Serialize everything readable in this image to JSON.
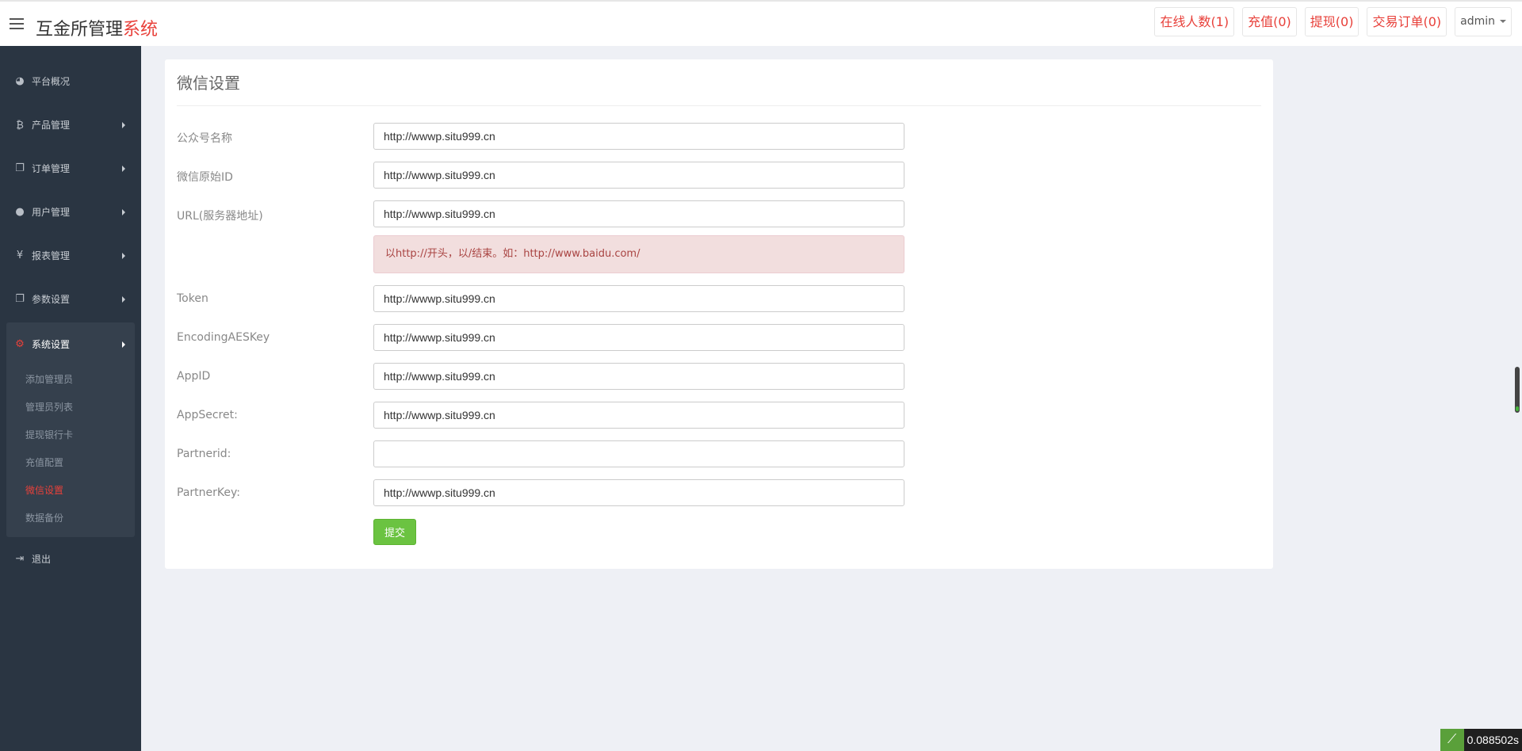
{
  "header": {
    "brand_main": "互金所管理",
    "brand_accent": "系统",
    "nav": {
      "online": "在线人数(1)",
      "recharge": "充值(0)",
      "withdraw": "提现(0)",
      "orders": "交易订单(0)",
      "user": "admin"
    }
  },
  "sidebar": {
    "items": [
      {
        "label": "平台概况",
        "icon": "dashboard-icon"
      },
      {
        "label": "产品管理",
        "icon": "bitcoin-icon"
      },
      {
        "label": "订单管理",
        "icon": "copy-icon"
      },
      {
        "label": "用户管理",
        "icon": "user-icon"
      },
      {
        "label": "报表管理",
        "icon": "yen-icon"
      },
      {
        "label": "参数设置",
        "icon": "copy-icon"
      },
      {
        "label": "系统设置",
        "icon": "gears-icon"
      },
      {
        "label": "退出",
        "icon": "sign-out-icon"
      }
    ],
    "sub_items": [
      "添加管理员",
      "管理员列表",
      "提现银行卡",
      "充值配置",
      "微信设置",
      "数据备份"
    ],
    "active_sub": "微信设置"
  },
  "panel": {
    "title": "微信设置",
    "fields": [
      {
        "label": "公众号名称",
        "value": "http://wwwp.situ999.cn"
      },
      {
        "label": "微信原始ID",
        "value": "http://wwwp.situ999.cn"
      },
      {
        "label": "URL(服务器地址)",
        "value": "http://wwwp.situ999.cn"
      },
      {
        "label": "Token",
        "value": "http://wwwp.situ999.cn"
      },
      {
        "label": "EncodingAESKey",
        "value": "http://wwwp.situ999.cn"
      },
      {
        "label": "AppID",
        "value": "http://wwwp.situ999.cn"
      },
      {
        "label": "AppSecret:",
        "value": "http://wwwp.situ999.cn"
      },
      {
        "label": "Partnerid:",
        "value": ""
      },
      {
        "label": "PartnerKey:",
        "value": "http://wwwp.situ999.cn"
      }
    ],
    "alert": "以http://开头，以/结束。如：http://www.baidu.com/",
    "submit": "提交"
  },
  "timer": "0.088502s",
  "colors": {
    "accent": "#e8403a",
    "sidebar_bg": "#2a3542",
    "submit": "#6bc341"
  }
}
